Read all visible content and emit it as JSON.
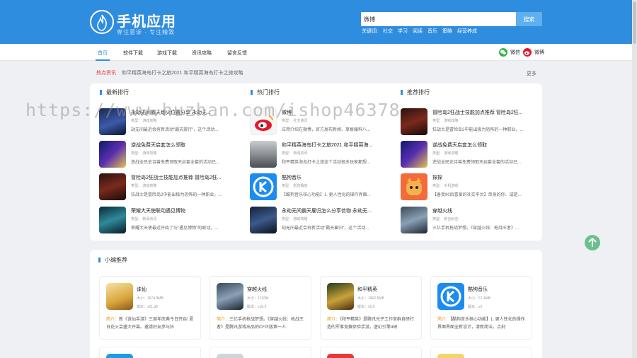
{
  "header": {
    "site_name": "手机应用",
    "slogan": "専注意诉 · 专注精致",
    "search": {
      "value": "微博",
      "button_label": "搜索"
    },
    "keywords_label": "关键词:",
    "keywords": [
      "社交",
      "学习",
      "阅读",
      "音乐",
      "策略",
      "经营养成"
    ]
  },
  "nav": {
    "items": [
      "首页",
      "软件下载",
      "游戏下载",
      "资讯攻略",
      "留言反馈"
    ],
    "share": [
      {
        "label": "微信",
        "icon": "wechat-icon"
      },
      {
        "label": "微博",
        "icon": "weibo-icon"
      }
    ]
  },
  "hot": {
    "label": "热点资讯",
    "text": "和平精英海岛打卡之旅2021 和平精英海岛打卡之旅攻略",
    "more": "更多"
  },
  "columns": [
    {
      "title": "最新排行",
      "items": [
        {
          "title": "永劫无间霸天烟火位置分享 永劫无...",
          "type": "类型:",
          "tname": "游戏攻略",
          "desc": "劫无间最近会有新活动\"霸天霞行\"，这个活动..."
        },
        {
          "title": "逆战免费天启套怎么领取",
          "type": "类型:",
          "tname": "游戏攻略",
          "desc": "逆战全民史诗兽免费领取天启套全套的活动已..."
        },
        {
          "title": "冒险岛2狂战士技能加点推荐 冒险岛2狂...",
          "type": "类型:",
          "tname": "游戏攻略",
          "desc": "狂战士是冒险岛2中能出极为恐怖的一种职业，..."
        },
        {
          "title": "荣耀大天使联动遇见博物",
          "type": "类型:",
          "tname": "新闻资讯",
          "desc": "荣耀大天使最近开始了与\"遇见博物\"的联动。..."
        }
      ]
    },
    {
      "title": "热门排行",
      "items": [
        {
          "title": "微博",
          "type": "类型:",
          "tname": "社交通讯",
          "desc": "应用介绍在微博，官方发布新闻、草根爆料八..."
        },
        {
          "title": "和平精英海岛打卡之旅2021 和平精英海...",
          "type": "类型:",
          "tname": "新闻资讯",
          "desc": "和平精英海岛打卡之旅这个活动很多玩家都想..."
        },
        {
          "title": "酷狗音乐",
          "type": "类型:",
          "tname": "影音播放",
          "desc": "【酷狗音乐核心功能】1. 更人性化的操作界面..."
        },
        {
          "title": "永劫无间霸天雇归怎么分享信物 永劫无...",
          "type": "类型:",
          "tname": "游戏攻略",
          "desc": "劫无间最近会有新活动\"霸天雇归\"，这个活动..."
        }
      ]
    },
    {
      "title": "推荐排行",
      "items": [
        {
          "title": "冒险岛2狂战士技能加点推荐 冒险岛2狂...",
          "type": "类型:",
          "tname": "游戏攻略",
          "desc": "狂战士是冒险岛2中能出极为恐怖的一种职业，..."
        },
        {
          "title": "逆战免费天启套怎么领取",
          "type": "类型:",
          "tname": "游戏攻略",
          "desc": "逆战全民史诗兽免费领取天启套全套的活动已..."
        },
        {
          "title": "探探",
          "type": "类型:",
          "tname": "手机游戏",
          "desc": "【备受90后喜爱的社交平台】单身的你、或是..."
        },
        {
          "title": "穿越火线",
          "type": "类型:",
          "tname": "枪击射击",
          "desc": "三亿手机枪战梦想。《穿越火线：枪战王者》..."
        }
      ]
    }
  ],
  "recommend": {
    "title": "小编推荐",
    "items": [
      {
        "name": "诛仙",
        "size": "大小：1674.9MB",
        "version": "版本：v21.36",
        "intro_label": "简介：",
        "intro": "新《诛仙手游》三周年庆典今日开启! 夏日花火会盛大开幕。邀请好友参与狂"
      },
      {
        "name": "穿越火线",
        "size": "大小：1210M",
        "version": "版本：v10.3",
        "intro_label": "简介：",
        "intro": "三亿手机枪战梦想。《穿越火线：枪战王者》是腾讯游戏出品的CF正版第一人"
      },
      {
        "name": "和平精英",
        "size": "大小：1662.6MB",
        "version": "版本：v5.9",
        "intro_label": "简介：",
        "intro": "《和平精英》是腾讯光子工作室群自研打造的军事竞赛体验手游，虚幻引擎4研"
      },
      {
        "name": "酷狗音乐",
        "size": "大小：67.4MB",
        "version": "版本：v2",
        "intro_label": "简介：",
        "intro": "【酷狗音乐核心功能】1. 更人性化的操作界面界面全新设计，清新简洁，点刻"
      }
    ]
  },
  "watermark": "https://www.huzhan.com/ishop46378",
  "colors": {
    "primary": "#2f8de0",
    "hot": "#e53935",
    "intro": "#f29100",
    "to_top": "#6cc08a"
  }
}
